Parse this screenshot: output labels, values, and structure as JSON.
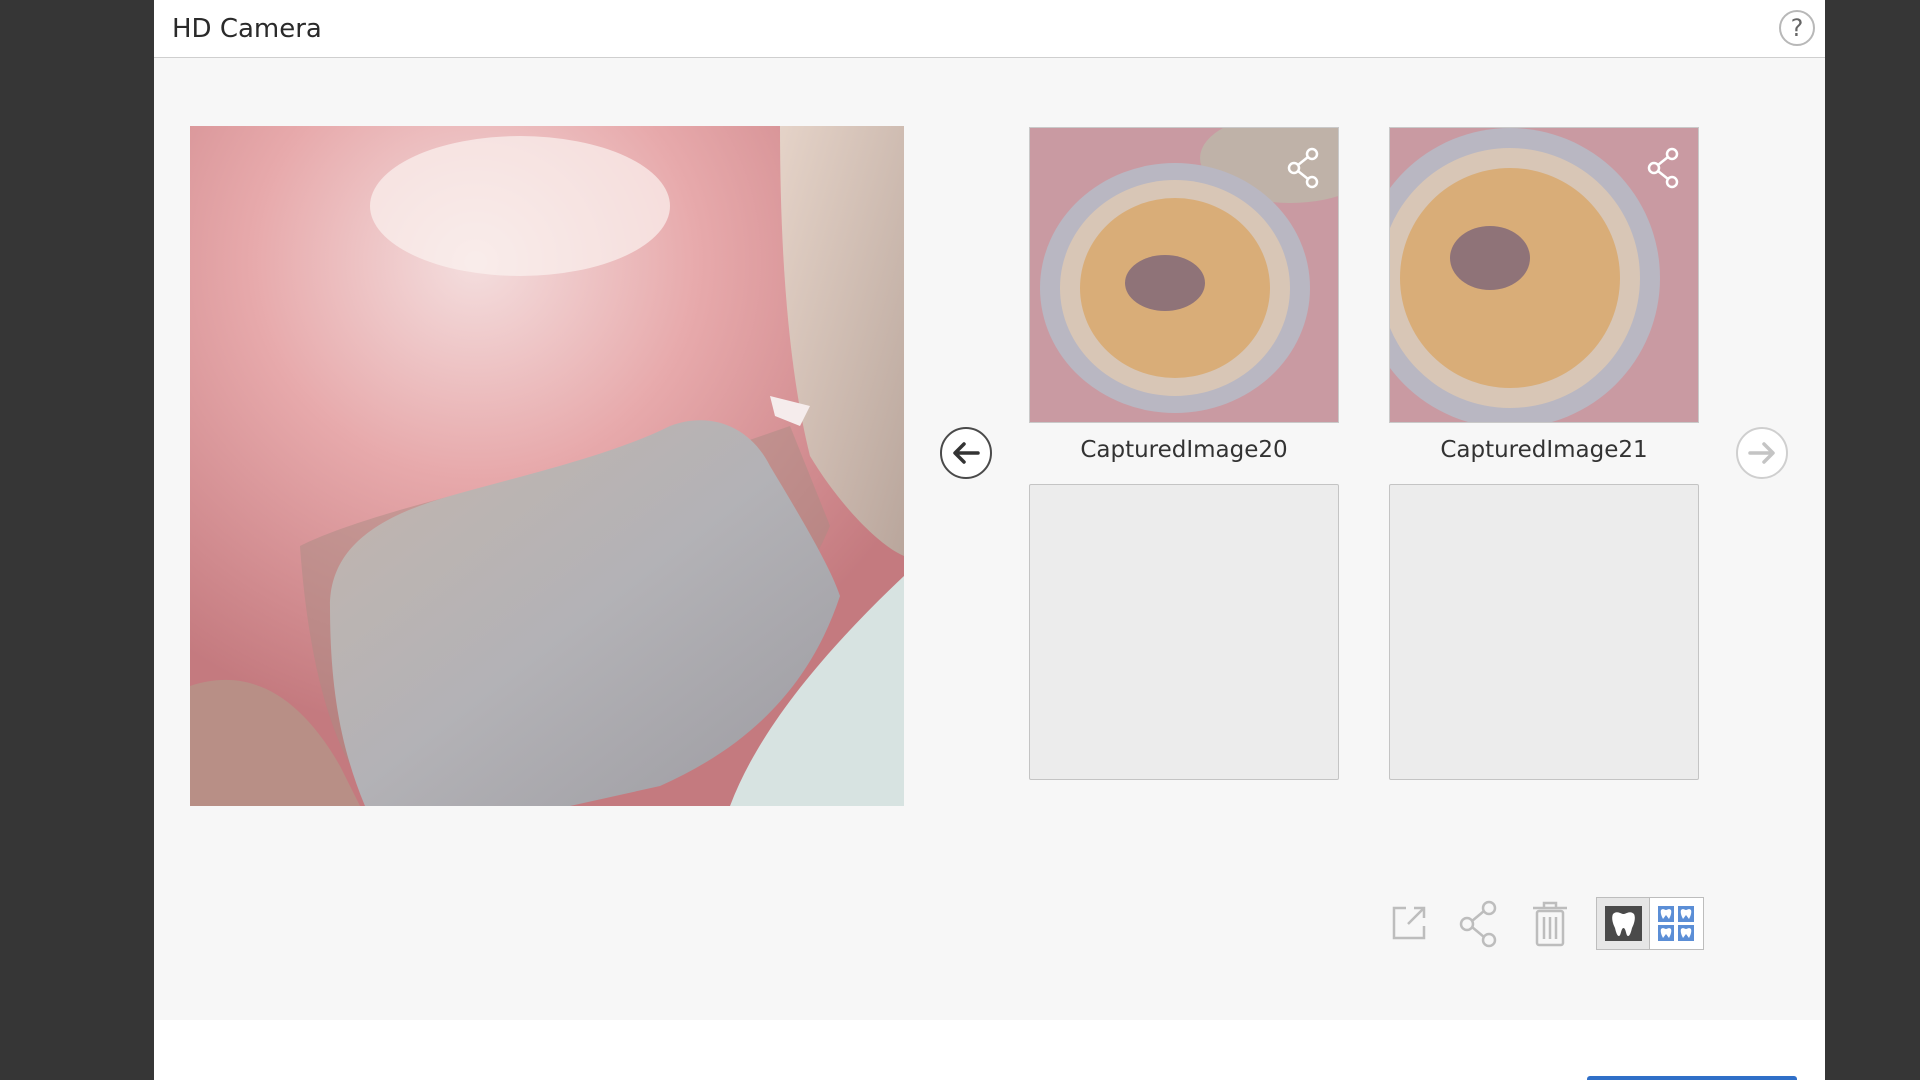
{
  "window": {
    "title": "HD Camera",
    "help_label": "?"
  },
  "main_view": {
    "alt": "intraoral camera live view"
  },
  "navigation": {
    "prev_icon": "arrow-left-icon",
    "next_icon": "arrow-right-icon"
  },
  "thumbnails": [
    {
      "label": "CapturedImage20",
      "overlay_icon": "share-icon"
    },
    {
      "label": "CapturedImage21",
      "overlay_icon": "share-icon"
    }
  ],
  "toolbar": {
    "export_icon": "export-icon",
    "share_icon": "share-icon",
    "delete_icon": "trash-icon",
    "single_view_icon": "tooth-icon",
    "grid_view_icon": "grid-tooth-icon"
  },
  "colors": {
    "accent": "#2f6fc8",
    "background": "#f7f7f7",
    "outer": "#363636"
  }
}
